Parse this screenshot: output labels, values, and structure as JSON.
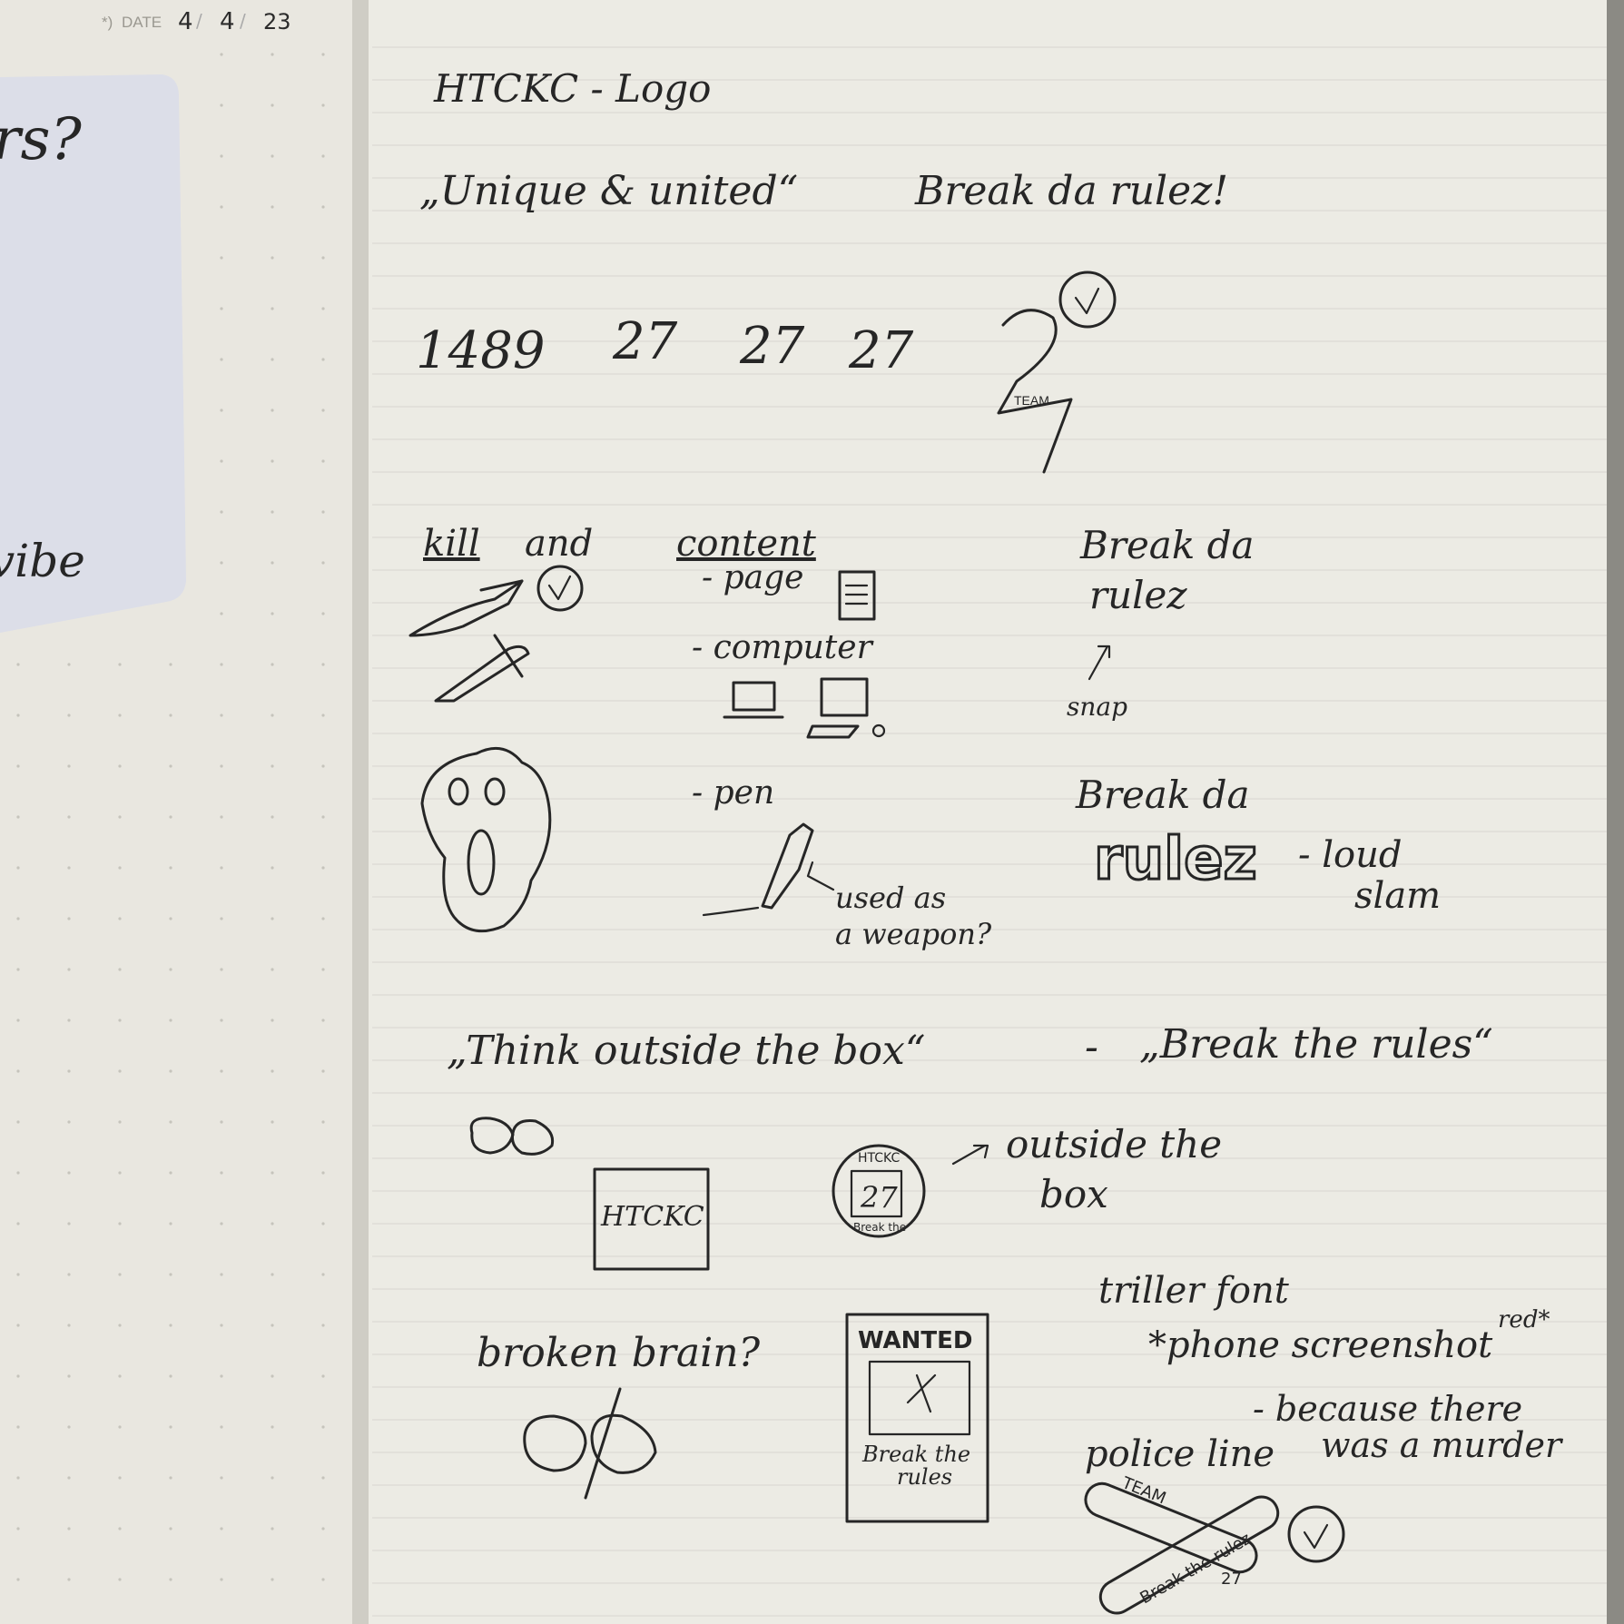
{
  "date_header": {
    "label": "DATE",
    "day": "4",
    "month": "4",
    "year": "23"
  },
  "left_page": {
    "sticky_note": {
      "line1": "rs?",
      "line2": "vibe"
    }
  },
  "right_page": {
    "title": "HTCKC - Logo",
    "slogans": {
      "unique": "„Unique & united“",
      "break": "Break da rulez!"
    },
    "numbers": {
      "n1": "1489",
      "n2": "27",
      "n3": "27",
      "n4": "27",
      "team_label": "TEAM"
    },
    "col1": {
      "kill": "kill",
      "and": "and"
    },
    "col2": {
      "heading": "content",
      "page": "- page",
      "computer": "- computer",
      "pen": "- pen",
      "pen_note_1": "used as",
      "pen_note_2": "a weapon?"
    },
    "col3": {
      "break_1": "Break da",
      "rulez_1": "rulez",
      "snap": "snap",
      "break_2": "Break da",
      "rulez_2": "rulez",
      "loud": "- loud",
      "slam": "slam"
    },
    "think": {
      "left": "„Think outside the box“",
      "dash": "-",
      "right": "„Break the rules“"
    },
    "boxes": {
      "box_label": "HTCKC",
      "badge_top": "HTCKC",
      "badge_num": "27",
      "badge_bottom": "Break the",
      "outside_1": "outside the",
      "outside_2": "box"
    },
    "bottom": {
      "broken_brain": "broken brain?",
      "wanted": "WANTED",
      "wanted_caption_1": "Break the",
      "wanted_caption_2": "rules",
      "triller": "triller font",
      "phone": "*phone screenshot",
      "red": "red*",
      "because_1": "- because there",
      "because_2": "was a murder",
      "police": "police line",
      "tape_1": "TEAM",
      "tape_2": "Break the rulez",
      "tape_3": "27"
    }
  }
}
